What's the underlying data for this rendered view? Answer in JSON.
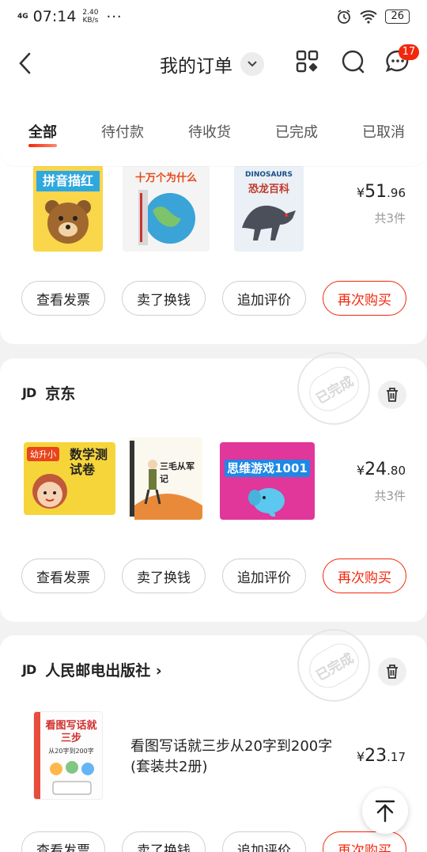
{
  "status": {
    "network": "4G",
    "time": "07:14",
    "speed_value": "2.40",
    "speed_unit": "KB/s",
    "dots": "···",
    "battery": "26"
  },
  "header": {
    "title": "我的订单",
    "message_badge": "17"
  },
  "tabs": [
    {
      "label": "全部",
      "active": true
    },
    {
      "label": "待付款"
    },
    {
      "label": "待收货"
    },
    {
      "label": "已完成"
    },
    {
      "label": "已取消"
    }
  ],
  "actions": {
    "invoice": "查看发票",
    "sell": "卖了换钱",
    "review": "追加评价",
    "rebuy": "再次购买"
  },
  "orders": [
    {
      "price_yen": "¥",
      "price_int": "51",
      "price_dec": ".96",
      "count": "共3件",
      "thumbs": [
        {
          "title": "拼音描红",
          "bg": "#f9d64a"
        },
        {
          "title": "十万个为什么",
          "bg": "#f4f4f4"
        },
        {
          "title": "恐龙百科",
          "subtitle": "DINOSAURS",
          "bg": "#eaf0f6"
        }
      ]
    },
    {
      "shop_logo": "JD",
      "shop": "京东",
      "status": "已完成",
      "price_yen": "¥",
      "price_int": "24",
      "price_dec": ".80",
      "count": "共3件",
      "thumbs": [
        {
          "title": "数学测试卷",
          "tag": "幼升小",
          "bg": "#f6d53b"
        },
        {
          "title": "三毛从军记",
          "bg": "#fbf8ef"
        },
        {
          "title": "思维游戏1001",
          "bg": "#e1369a"
        }
      ]
    },
    {
      "shop_logo": "JD",
      "shop": "人民邮电出版社 ›",
      "status": "已完成",
      "product_name": "看图写话就三步从20字到200字(套装共2册)",
      "thumb_title": "看图写话就三步",
      "thumb_sub": "从20字到200字",
      "price_yen": "¥",
      "price_int": "23",
      "price_dec": ".17"
    }
  ]
}
